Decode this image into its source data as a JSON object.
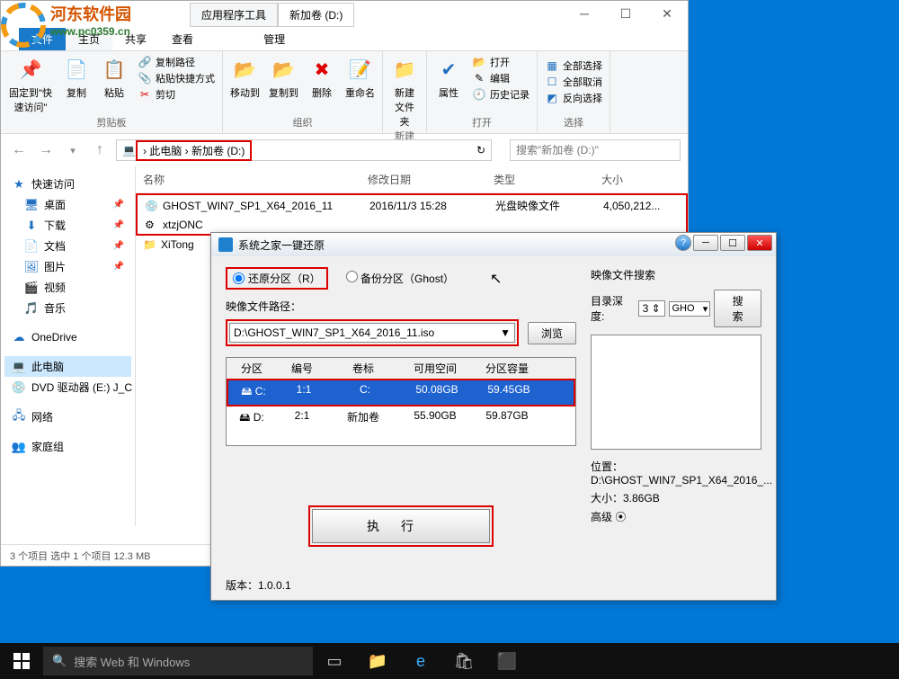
{
  "watermark": {
    "text": "河东软件园",
    "url": "www.pc0359.cn"
  },
  "explorer": {
    "title_tabs": [
      "应用程序工具",
      "新加卷 (D:)"
    ],
    "ribbon_tab_file": "文件",
    "ribbon_tab_home": "主页",
    "ribbon_tab_share": "共享",
    "ribbon_tab_view": "查看",
    "ribbon_tab_manage": "管理",
    "pin_label": "固定到\"快速访问\"",
    "copy_label": "复制",
    "paste_label": "粘贴",
    "copy_path": "复制路径",
    "paste_shortcut": "粘贴快捷方式",
    "cut_label": "剪切",
    "clipboard_group": "剪贴板",
    "move_to": "移动到",
    "copy_to": "复制到",
    "delete_label": "删除",
    "rename_label": "重命名",
    "organize_group": "组织",
    "new_folder": "新建文件夹",
    "new_group": "新建",
    "properties_label": "属性",
    "open_label": "打开",
    "edit_label": "编辑",
    "history_label": "历史记录",
    "open_group": "打开",
    "select_all": "全部选择",
    "select_none": "全部取消",
    "select_invert": "反向选择",
    "select_group": "选择",
    "breadcrumb_pc": "此电脑",
    "breadcrumb_vol": "新加卷 (D:)",
    "search_placeholder": "搜索\"新加卷 (D:)\"",
    "col_name": "名称",
    "col_date": "修改日期",
    "col_type": "类型",
    "col_size": "大小",
    "files": [
      {
        "icon": "💿",
        "name": "GHOST_WIN7_SP1_X64_2016_11",
        "date": "2016/11/3 15:28",
        "type": "光盘映像文件",
        "size": "4,050,212..."
      },
      {
        "icon": "⚙",
        "name": "xtzjONC",
        "date": "",
        "type": "",
        "size": ""
      },
      {
        "icon": "📁",
        "name": "XiTong",
        "date": "",
        "type": "",
        "size": ""
      }
    ],
    "sidebar": {
      "quick_access": "快速访问",
      "desktop": "桌面",
      "downloads": "下载",
      "documents": "文档",
      "pictures": "图片",
      "videos": "视频",
      "music": "音乐",
      "onedrive": "OneDrive",
      "this_pc": "此电脑",
      "dvd": "DVD 驱动器 (E:) J_C",
      "network": "网络",
      "homegroup": "家庭组"
    },
    "status": "3 个项目    选中 1 个项目  12.3 MB"
  },
  "dialog": {
    "title": "系统之家一键还原",
    "restore_label": "还原分区（R）",
    "backup_label": "备份分区（Ghost）",
    "path_label": "映像文件路径：",
    "path_value": "D:\\GHOST_WIN7_SP1_X64_2016_11.iso",
    "browse_btn": "浏览",
    "cols": {
      "part": "分区",
      "num": "编号",
      "label": "卷标",
      "free": "可用空间",
      "total": "分区容量"
    },
    "rows": [
      {
        "part": "C:",
        "num": "1:1",
        "label": "C:",
        "free": "50.08GB",
        "total": "59.45GB"
      },
      {
        "part": "D:",
        "num": "2:1",
        "label": "新加卷",
        "free": "55.90GB",
        "total": "59.87GB"
      }
    ],
    "execute_btn": "执行",
    "search_title": "映像文件搜索",
    "depth_label": "目录深度:",
    "depth_value": "3",
    "ext_value": "GHO",
    "search_btn": "搜索",
    "location_label": "位置：D:\\GHOST_WIN7_SP1_X64_2016_...",
    "size_label": "大小：3.86GB",
    "advanced_label": "高级",
    "version_label": "版本：1.0.0.1"
  },
  "taskbar": {
    "search_placeholder": "搜索 Web 和 Windows"
  }
}
